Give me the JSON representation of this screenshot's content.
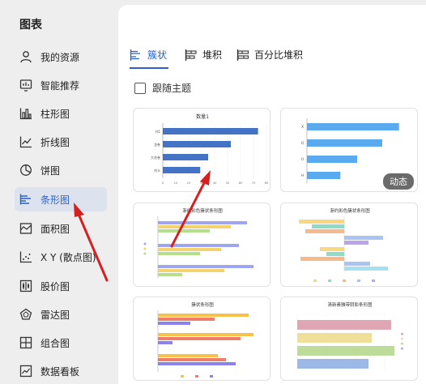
{
  "sidebar": {
    "title": "图表",
    "items": [
      {
        "label": "我的资源",
        "icon": "user-icon"
      },
      {
        "label": "智能推荐",
        "icon": "smart-recommend-icon"
      },
      {
        "label": "柱形图",
        "icon": "column-chart-icon"
      },
      {
        "label": "折线图",
        "icon": "line-chart-icon"
      },
      {
        "label": "饼图",
        "icon": "pie-chart-icon"
      },
      {
        "label": "条形图",
        "icon": "bar-chart-icon",
        "active": true
      },
      {
        "label": "面积图",
        "icon": "area-chart-icon"
      },
      {
        "label": "X Y (散点图)",
        "icon": "scatter-chart-icon"
      },
      {
        "label": "股价图",
        "icon": "stock-chart-icon"
      },
      {
        "label": "雷达图",
        "icon": "radar-chart-icon"
      },
      {
        "label": "组合图",
        "icon": "combo-chart-icon"
      },
      {
        "label": "数据看板",
        "icon": "dashboard-icon"
      }
    ]
  },
  "tabs": [
    {
      "label": "簇状",
      "icon": "clustered-bar-icon",
      "active": true
    },
    {
      "label": "堆积",
      "icon": "stacked-bar-icon"
    },
    {
      "label": "百分比堆积",
      "icon": "percent-stacked-bar-icon"
    }
  ],
  "follow_theme": {
    "label": "跟随主题",
    "checked": false
  },
  "colors": {
    "accent": "#2a62c9",
    "arrow": "#d42020"
  },
  "cards": [
    {
      "title": "数量1",
      "categories": [
        "刘1",
        "龙卷",
        "大花卷",
        "刘卡"
      ],
      "values": [
        84,
        60,
        40,
        33
      ],
      "x_ticks": [
        "0",
        "10",
        "20",
        "30",
        "40",
        "50",
        "60",
        "70",
        "80",
        "90"
      ]
    },
    {
      "title": "",
      "categories": [
        "X",
        "Q",
        "O",
        "H"
      ],
      "values": [
        44,
        36,
        24,
        16
      ],
      "badge": "动态"
    },
    {
      "title": "渐约彩色簇状条形图"
    },
    {
      "title": "渐约彩色簇状条形图"
    },
    {
      "title": "簇状条形图"
    },
    {
      "title": "清新素雅带阴影条形图"
    }
  ]
}
